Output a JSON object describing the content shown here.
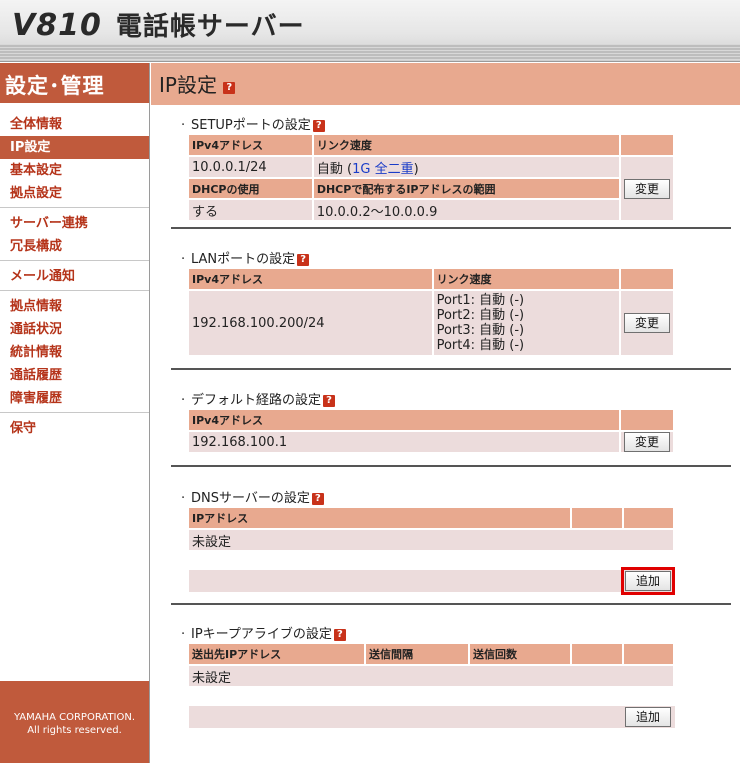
{
  "header": {
    "model": "V810",
    "product": "電話帳サーバー"
  },
  "sidebar": {
    "title": "設定･管理",
    "groups": [
      [
        "全体情報",
        "IP設定",
        "基本設定",
        "拠点設定"
      ],
      [
        "サーバー連携",
        "冗長構成"
      ],
      [
        "メール通知"
      ],
      [
        "拠点情報",
        "通話状況",
        "統計情報",
        "通話履歴",
        "障害履歴"
      ],
      [
        "保守"
      ]
    ],
    "active": "IP設定",
    "footer_line1": "YAMAHA CORPORATION.",
    "footer_line2": "All rights reserved."
  },
  "main": {
    "title": "IP設定",
    "help_glyph": "?",
    "setup_port": {
      "title": "SETUPポートの設定",
      "col_ipv4": "IPv4アドレス",
      "col_speed": "リンク速度",
      "ipv4": "10.0.0.1/24",
      "speed_prefix": "自動 (",
      "speed_1g": "1G",
      "speed_duplex": "全二重",
      "speed_suffix": ")",
      "col_dhcp": "DHCPの使用",
      "col_dhcp_range": "DHCPで配布するIPアドレスの範囲",
      "dhcp": "する",
      "dhcp_range": "10.0.0.2～10.0.0.9",
      "change_button": "変更"
    },
    "lan_port": {
      "title": "LANポートの設定",
      "col_ipv4": "IPv4アドレス",
      "col_speed": "リンク速度",
      "ipv4": "192.168.100.200/24",
      "ports": [
        "Port1: 自動 (-)",
        "Port2: 自動 (-)",
        "Port3: 自動 (-)",
        "Port4: 自動 (-)"
      ],
      "change_button": "変更"
    },
    "default_route": {
      "title": "デフォルト経路の設定",
      "col_ipv4": "IPv4アドレス",
      "ipv4": "192.168.100.1",
      "change_button": "変更"
    },
    "dns": {
      "title": "DNSサーバーの設定",
      "col_ip": "IPアドレス",
      "value": "未設定",
      "add_button": "追加"
    },
    "keepalive": {
      "title": "IPキープアライブの設定",
      "col_dest": "送出先IPアドレス",
      "col_interval": "送信間隔",
      "col_count": "送信回数",
      "value": "未設定",
      "add_button": "追加"
    }
  }
}
